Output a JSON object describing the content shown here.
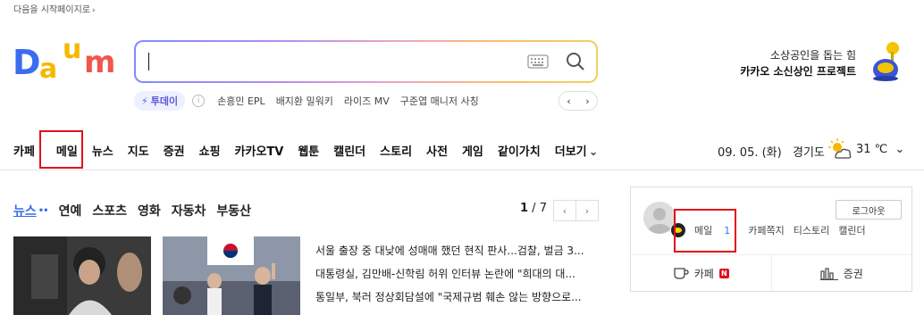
{
  "top_note": {
    "text": "다음을 시작페이지로",
    "arrow": "›"
  },
  "logo": {
    "letters": [
      "D",
      "a",
      "u",
      "m"
    ]
  },
  "search": {
    "value": "",
    "icons": [
      "keyboard-icon",
      "search-icon"
    ]
  },
  "quick": {
    "today_label": "투데이",
    "info": "i",
    "keywords": [
      "손흥민 EPL",
      "배지환 밀워키",
      "라이즈 MV",
      "구준엽 매니저 사칭"
    ],
    "prev": "‹",
    "next": "›"
  },
  "promo": {
    "line1": "소상공인을 돕는 힘",
    "line2": "카카오 소신상인 프로젝트"
  },
  "nav": {
    "items": [
      "카페",
      "메일",
      "뉴스",
      "지도",
      "증권",
      "쇼핑",
      "카카오TV",
      "웹툰",
      "캘린더",
      "스토리",
      "사전",
      "게임",
      "같이가치",
      "더보기"
    ],
    "more_arrow": "⌄",
    "date": "09. 05. (화)",
    "region": "경기도",
    "temp": "31 ℃",
    "temp_arrow": "⌄"
  },
  "news": {
    "tabs": [
      "뉴스",
      "연예",
      "스포츠",
      "영화",
      "자동차",
      "부동산"
    ],
    "active_tab_marker": "••",
    "page_current": "1",
    "page_sep": " / ",
    "page_total": "7",
    "prev": "‹",
    "next": "›",
    "headlines": [
      "서울 출장 중 대낮에 성매매 했던 현직 판사...검찰, 벌금 3...",
      "대통령실, 김만배-신학림 허위 인터뷰 논란에 \"희대의 대...",
      "통일부, 북러 정상회담설에 \"국제규범 훼손 않는 방향으로..."
    ]
  },
  "panel": {
    "logout": "로그아웃",
    "mail_label": "메일",
    "mail_count": "1",
    "cafe_note": "카페쪽지",
    "tistory": "티스토리",
    "calendar": "캘린더",
    "cafe": "카페",
    "cafe_badge": "N",
    "stock": "증권"
  },
  "colors": {
    "highlight": "#e0111b",
    "accent": "#3a6be8"
  }
}
